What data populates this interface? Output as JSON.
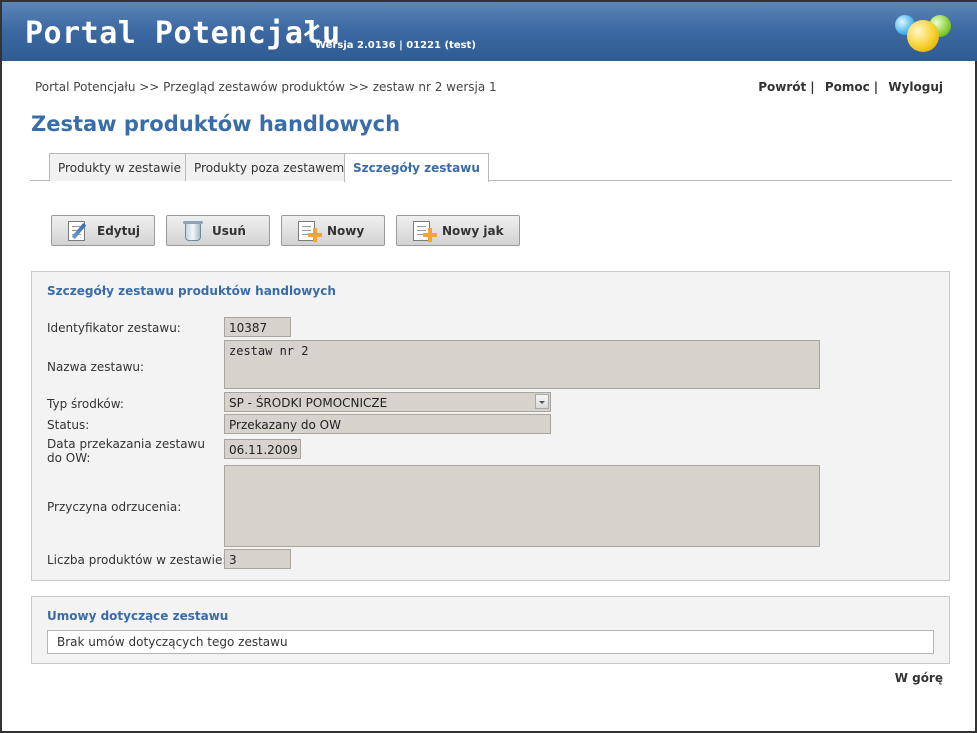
{
  "header": {
    "title": "Portal Potencjału",
    "version": "Wersja 2.0136 | 01221 (test)"
  },
  "breadcrumb": "Portal Potencjału >> Przegląd zestawów produktów >> zestaw nr 2 wersja 1",
  "toplinks": {
    "back": "Powrót",
    "help": "Pomoc",
    "logout": "Wyloguj",
    "separator": "|"
  },
  "page_title": "Zestaw produktów handlowych",
  "tabs": [
    {
      "label": "Produkty w zestawie",
      "active": false
    },
    {
      "label": "Produkty poza zestawem",
      "active": false
    },
    {
      "label": "Szczegóły zestawu",
      "active": true
    }
  ],
  "actions": {
    "edit": "Edytuj",
    "delete": "Usuń",
    "new": "Nowy",
    "new_like": "Nowy jak"
  },
  "details": {
    "heading": "Szczegóły zestawu produktów handlowych",
    "id_label": "Identyfikator zestawu:",
    "id_value": "10387",
    "name_label": "Nazwa zestawu:",
    "name_value": "zestaw nr 2",
    "type_label": "Typ środków:",
    "type_value": "SP - ŚRODKI POMOCNICZE",
    "status_label": "Status:",
    "status_value": "Przekazany do OW",
    "date_label": "Data przekazania zestawu do OW:",
    "date_value": "06.11.2009",
    "reason_label": "Przyczyna odrzucenia:",
    "reason_value": "",
    "count_label": "Liczba produktów w zestawie:",
    "count_value": "3"
  },
  "contracts": {
    "heading": "Umowy dotyczące zestawu",
    "empty_text": "Brak umów dotyczących tego zestawu"
  },
  "back_to_top": "W górę",
  "colors": {
    "header_blue": "#3d6aa2",
    "accent_blue": "#3a6ca8",
    "field_bg": "#d6d2cc",
    "button_plus": "#f2a33a"
  },
  "icons": {
    "edit": "edit-document-pencil-icon",
    "delete": "trash-bin-icon",
    "new": "new-document-plus-icon",
    "new_like": "new-document-plus-icon",
    "dropdown": "chevron-down-icon"
  }
}
